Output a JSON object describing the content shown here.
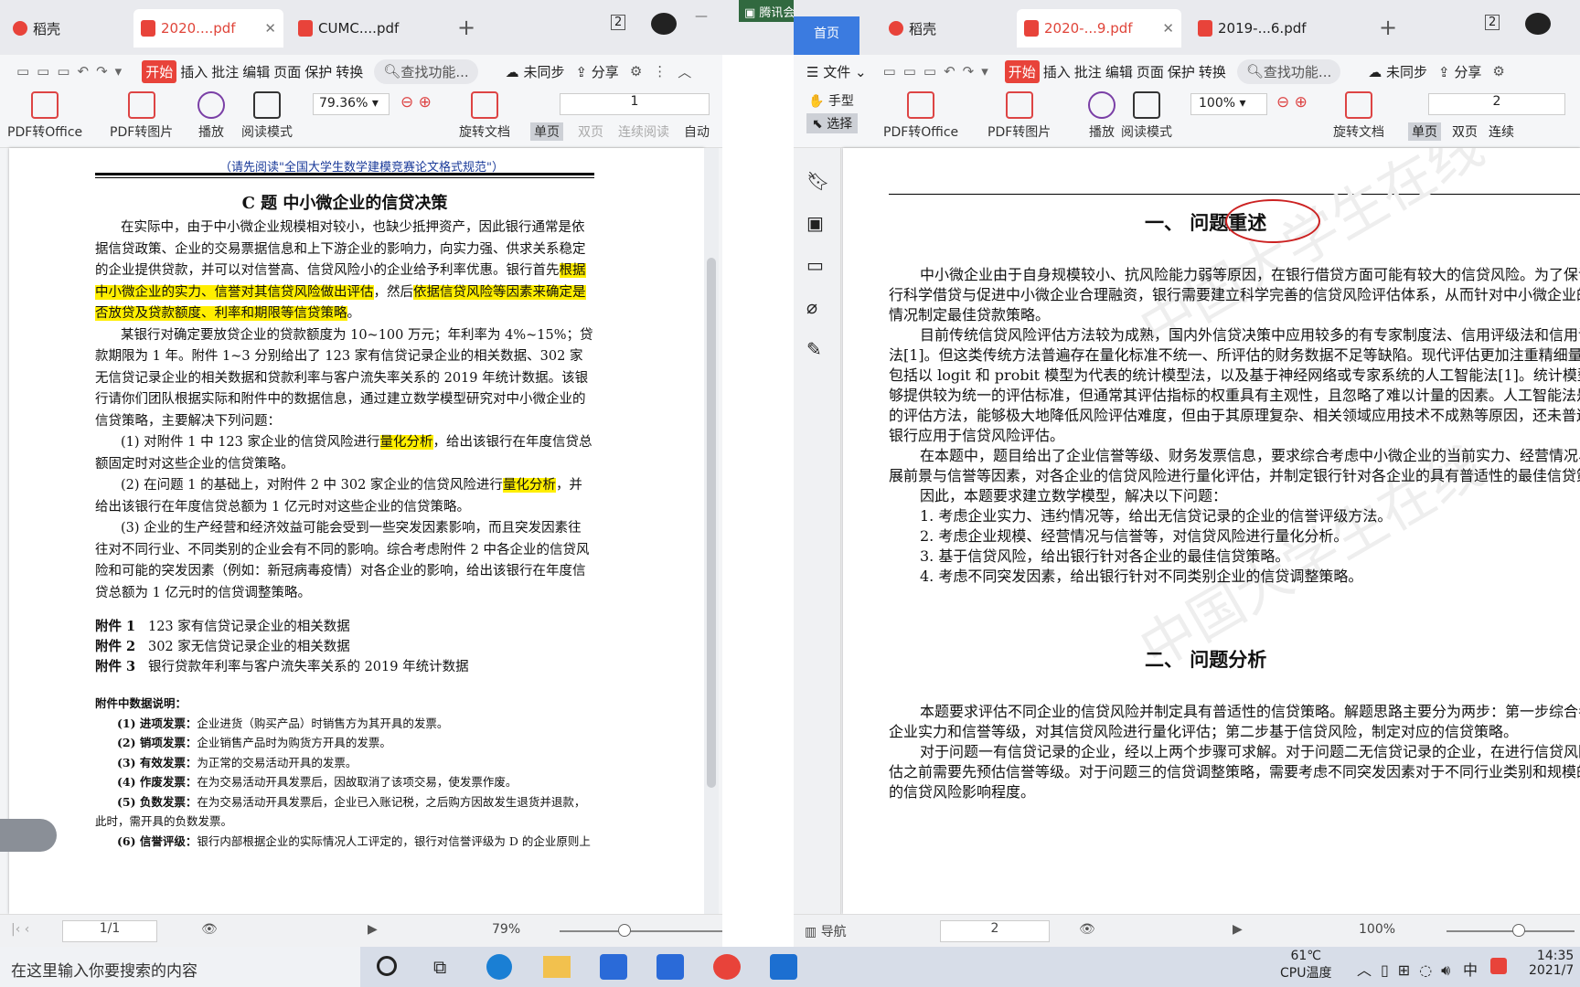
{
  "left": {
    "tabs": [
      {
        "label": "稻壳"
      },
      {
        "label": "2020....pdf"
      },
      {
        "label": "CUMC....pdf"
      }
    ],
    "tab_badge": "2",
    "toolbar1": {
      "kaishi": "开始",
      "items": [
        "插入",
        "批注",
        "编辑",
        "页面",
        "保护",
        "转换"
      ],
      "search": "查找功能...",
      "sync": "未同步",
      "share": "分享"
    },
    "toolbar2": {
      "pdf_office": "PDF转Office",
      "pdf_img": "PDF转图片",
      "play": "播放",
      "read": "阅读模式",
      "zoom": "79.36%",
      "page": "1",
      "rotate": "旋转文档",
      "single": "单页",
      "double": "双页",
      "continuous": "连续阅读",
      "auto": "自动"
    },
    "doc": {
      "notice": "（请先阅读\"全国大学生数学建模竞赛论文格式规范\"）",
      "title": "C 题   中小微企业的信贷决策",
      "p1a": "在实际中，由于中小微企业规模相对较小，也缺少抵押资产，因此银行通常是依据信贷政策、企业的交易票据信息和上下游企业的影响力，向实力强、供求关系稳定的企业提供贷款，并可以对信誉高、信贷风险小的企业给予利率优惠。银行首先",
      "p1b": "根据中小微企业的实力、信誉对其信贷风险做出评估",
      "p1c": "，然后",
      "p1d": "依据信贷风险等因素来确定是否放贷及贷款额度、利率和期限等信贷策略",
      "p1e": "。",
      "p2": "某银行对确定要放贷企业的贷款额度为 10~100 万元；年利率为 4%~15%；贷款期限为 1 年。附件 1~3 分别给出了 123 家有信贷记录企业的相关数据、302 家无信贷记录企业的相关数据和贷款利率与客户流失率关系的 2019 年统计数据。该银行请你们团队根据实际和附件中的数据信息，通过建立数学模型研究对中小微企业的信贷策略，主要解决下列问题：",
      "q1a": "(1) 对附件 1 中 123 家企业的信贷风险进行",
      "q1b": "量化分析",
      "q1c": "，给出该银行在年度信贷总额固定时对这些企业的信贷策略。",
      "q2a": "(2) 在问题 1 的基础上，对附件 2 中 302 家企业的信贷风险进行",
      "q2b": "量化分析",
      "q2c": "，并给出该银行在年度信贷总额为 1 亿元时对这些企业的信贷策略。",
      "q3": "(3) 企业的生产经营和经济效益可能会受到一些突发因素影响，而且突发因素往往对不同行业、不同类别的企业会有不同的影响。综合考虑附件 2 中各企业的信贷风险和可能的突发因素（例如：新冠病毒疫情）对各企业的影响，给出该银行在年度信贷总额为 1 亿元时的信贷调整策略。",
      "att1k": "附件 1",
      "att1v": "123 家有信贷记录企业的相关数据",
      "att2k": "附件 2",
      "att2v": "302 家无信贷记录企业的相关数据",
      "att3k": "附件 3",
      "att3v": "银行贷款年利率与客户流失率关系的 2019 年统计数据",
      "expl": "附件中数据说明：",
      "d1k": "(1) 进项发票：",
      "d1v": "企业进货（购买产品）时销售方为其开具的发票。",
      "d2k": "(2) 销项发票：",
      "d2v": "企业销售产品时为购货方开具的发票。",
      "d3k": "(3) 有效发票：",
      "d3v": "为正常的交易活动开具的发票。",
      "d4k": "(4) 作废发票：",
      "d4v": "在为交易活动开具发票后，因故取消了该项交易，使发票作废。",
      "d5k": "(5) 负数发票：",
      "d5v": "在为交易活动开具发票后，企业已入账记税，之后购方因故发生退货并退款，此时，需开具的负数发票。",
      "d6k": "(6) 信誉评级：",
      "d6v": "银行内部根据企业的实际情况人工评定的，银行对信誉评级为 D 的企业原则上"
    },
    "status": {
      "page": "1/1",
      "zoom": "79%"
    }
  },
  "meeting": "腾讯会议",
  "right": {
    "home_tab": "首页",
    "tabs": [
      {
        "label": "稻壳"
      },
      {
        "label": "2020-...9.pdf"
      },
      {
        "label": "2019-...6.pdf"
      }
    ],
    "tab_badge": "2",
    "toolbar1": {
      "file": "文件",
      "kaishi": "开始",
      "items": [
        "插入",
        "批注",
        "编辑",
        "页面",
        "保护",
        "转换"
      ],
      "search": "查找功能...",
      "sync": "未同步",
      "share": "分享"
    },
    "toolbar2": {
      "hand": "手型",
      "select": "选择",
      "pdf_office": "PDF转Office",
      "pdf_img": "PDF转图片",
      "play": "播放",
      "read": "阅读模式",
      "zoom": "100%",
      "page": "2",
      "rotate": "旋转文档",
      "single": "单页",
      "double": "双页",
      "continuous": "连续"
    },
    "doc": {
      "h1": "一、  问题重述",
      "p1": "中小微企业由于自身规模较小、抗风险能力弱等原因，在银行借贷方面可能有较大的信贷风险。为了保证银行科学借贷与促进中小微企业合理融资，银行需要建立科学完善的信贷风险评估体系，从而针对中小微企业的具体情况制定最佳贷款策略。",
      "p2": "目前传统信贷风险评估方法较为成熟，国内外信贷决策中应用较多的有专家制度法、信用评级法和信用评分法[1]。但这类传统方法普遍存在量化标准不统一、所评估的财务数据不足等缺陷。现代评估更加注重精细量化，包括以 logit 和 probit 模型为代表的统计模型法，以及基于神经网络或专家系统的人工智能法[1]。统计模型能够提供较为统一的评估标准，但通常其评估指标的权重具有主观性，且忽略了难以计量的因素。人工智能法是新兴的评估方法，能够极大地降低风险评估难度，但由于其原理复杂、相关领域应用技术不成熟等原因，还未普遍地被银行应用于信贷风险评估。",
      "p3": "在本题中，题目给出了企业信誉等级、财务发票信息，要求综合考虑中小微企业的当前实力、经营情况、发展前景与信誉等因素，对各企业的信贷风险进行量化评估，并制定银行针对各企业的具有普适性的最佳信贷策略。",
      "p4": "因此，本题要求建立数学模型，解决以下问题：",
      "l1": "1.    考虑企业实力、违约情况等，给出无信贷记录的企业的信誉评级方法。",
      "l2": "2.    考虑企业规模、经营情况与信誉等，对信贷风险进行量化分析。",
      "l3": "3.    基于信贷风险，给出银行针对各企业的最佳信贷策略。",
      "l4": "4.    考虑不同突发因素，给出银行针对不同类别企业的信贷调整策略。",
      "h2": "二、  问题分析",
      "p5": "本题要求评估不同企业的信贷风险并制定具有普适性的信贷策略。解题思路主要分为两步：第一步综合考虑企业实力和信誉等级，对其信贷风险进行量化评估；第二步基于信贷风险，制定对应的信贷策略。",
      "p6": "对于问题一有信贷记录的企业，经以上两个步骤可求解。对于问题二无信贷记录的企业，在进行信贷风险评估之前需要先预估信誉等级。对于问题三的信贷调整策略，需要考虑不同突发因素对于不同行业类别和规模的企业的信贷风险影响程度。",
      "watermark": "中国大学生在线"
    },
    "status": {
      "nav": "导航",
      "page": "2",
      "zoom": "100%"
    }
  },
  "taskbar": {
    "search": "在这里输入你要搜索的内容",
    "temp": "61℃",
    "temp_label": "CPU温度",
    "ime": "中",
    "time": "14:35",
    "date": "2021/7"
  }
}
